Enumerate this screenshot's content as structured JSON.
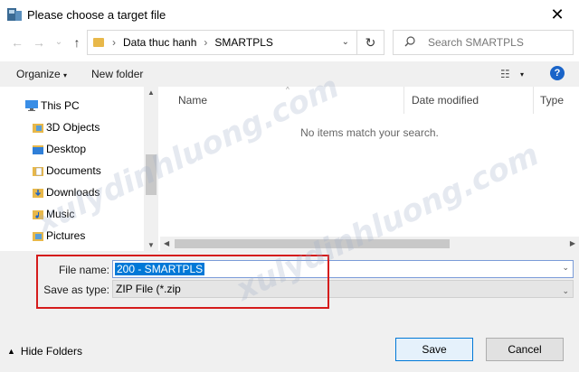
{
  "window": {
    "title": "Please choose a target file",
    "close_glyph": "✕"
  },
  "nav": {
    "back_glyph": "←",
    "forward_glyph": "→",
    "recent_glyph": "⌄",
    "up_glyph": "↑",
    "breadcrumb": [
      "Data thuc hanh",
      "SMARTPLS"
    ],
    "separator": "›",
    "refresh_glyph": "↻",
    "search_placeholder": "Search SMARTPLS"
  },
  "toolbar": {
    "organize_label": "Organize",
    "organize_arrow": "▾",
    "new_folder_label": "New folder",
    "view_glyph": "☷",
    "view_arrow": "▾",
    "help_label": "?"
  },
  "sidebar": {
    "items": [
      {
        "label": "This PC",
        "icon": "pc-icon"
      },
      {
        "label": "3D Objects",
        "icon": "folder-3d-icon"
      },
      {
        "label": "Desktop",
        "icon": "folder-desktop-icon"
      },
      {
        "label": "Documents",
        "icon": "folder-documents-icon"
      },
      {
        "label": "Downloads",
        "icon": "folder-downloads-icon"
      },
      {
        "label": "Music",
        "icon": "folder-music-icon"
      },
      {
        "label": "Pictures",
        "icon": "folder-pictures-icon"
      }
    ]
  },
  "filelist": {
    "columns": [
      "Name",
      "Date modified",
      "Type"
    ],
    "empty_message": "No items match your search."
  },
  "form": {
    "filename_label": "File name:",
    "filename_value": "200 - SMARTPLS",
    "savetype_label": "Save as type:",
    "savetype_value": "ZIP File (*.zip"
  },
  "footer": {
    "hide_folders_label": "Hide Folders",
    "save_label": "Save",
    "cancel_label": "Cancel"
  },
  "watermark": {
    "text": "xulydinhluong.com"
  },
  "colors": {
    "accent": "#0078d7",
    "highlight_box": "#d51c1c",
    "folder": "#e8b84a"
  }
}
